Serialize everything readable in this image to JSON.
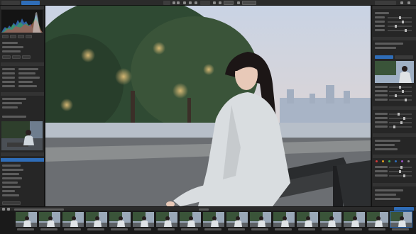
{
  "colors": {
    "accent": "#2f6db8",
    "panel": "#262626",
    "toolbar": "#2b2b2b",
    "filmstrip": "#1a1a1a"
  },
  "toolbar": {
    "left_tab_label": "",
    "active_tab_label": "",
    "field_value": "",
    "right_field_value": ""
  },
  "left_panel": {
    "histogram_header": "",
    "thumbnail_caption": "",
    "selected_row_label": ""
  },
  "right_panel": {
    "header": "",
    "tab_1": "",
    "tab_2": "",
    "swatch_colors": [
      "#d23a3a",
      "#e0a020",
      "#3aa85a",
      "#2f6db8",
      "#9a4fc8",
      "#8a8a8a"
    ]
  },
  "filmstrip": {
    "selected_index": 16,
    "frame_count": 17,
    "frame_icons": [
      "portrait",
      "portrait",
      "portrait",
      "portrait",
      "portrait",
      "portrait",
      "portrait",
      "portrait",
      "portrait",
      "portrait",
      "portrait",
      "portrait",
      "portrait",
      "portrait",
      "portrait",
      "portrait",
      "portrait"
    ]
  },
  "main_image": {
    "subject": "photo-portrait"
  }
}
